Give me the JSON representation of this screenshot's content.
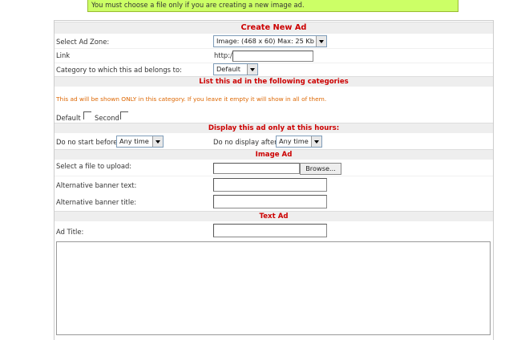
{
  "notice": "You must choose a file only if you are creating a new image ad.",
  "create": {
    "title": "Create New Ad",
    "zone_label": "Select Ad Zone:",
    "zone_value": "Image: (468 x 60) Max: 25 Kb",
    "link_label": "Link",
    "link_prefix": "http://",
    "category_label": "Category to which this ad belongs to:",
    "category_value": "Default"
  },
  "categories": {
    "title": "List this ad in the following categories",
    "note": "This ad will be shown ONLY in this category. If you leave it empty it will show in all of them.",
    "items": [
      "Default",
      "Second"
    ]
  },
  "hours": {
    "title": "Display this ad only at this hours:",
    "start_label": "Do no start before:",
    "start_value": "Any time",
    "end_label": "Do no display after:",
    "end_value": "Any time"
  },
  "image_ad": {
    "title": "Image Ad",
    "file_label": "Select a file to upload:",
    "browse_label": "Browse...",
    "alt_text_label": "Alternative banner text:",
    "alt_title_label": "Alternative banner title:"
  },
  "text_ad": {
    "title": "Text Ad",
    "ad_title_label": "Ad Title:"
  },
  "colors": {
    "notice_bg": "#ccff66",
    "header_text": "#cc0000",
    "note_text": "#dd6600"
  }
}
